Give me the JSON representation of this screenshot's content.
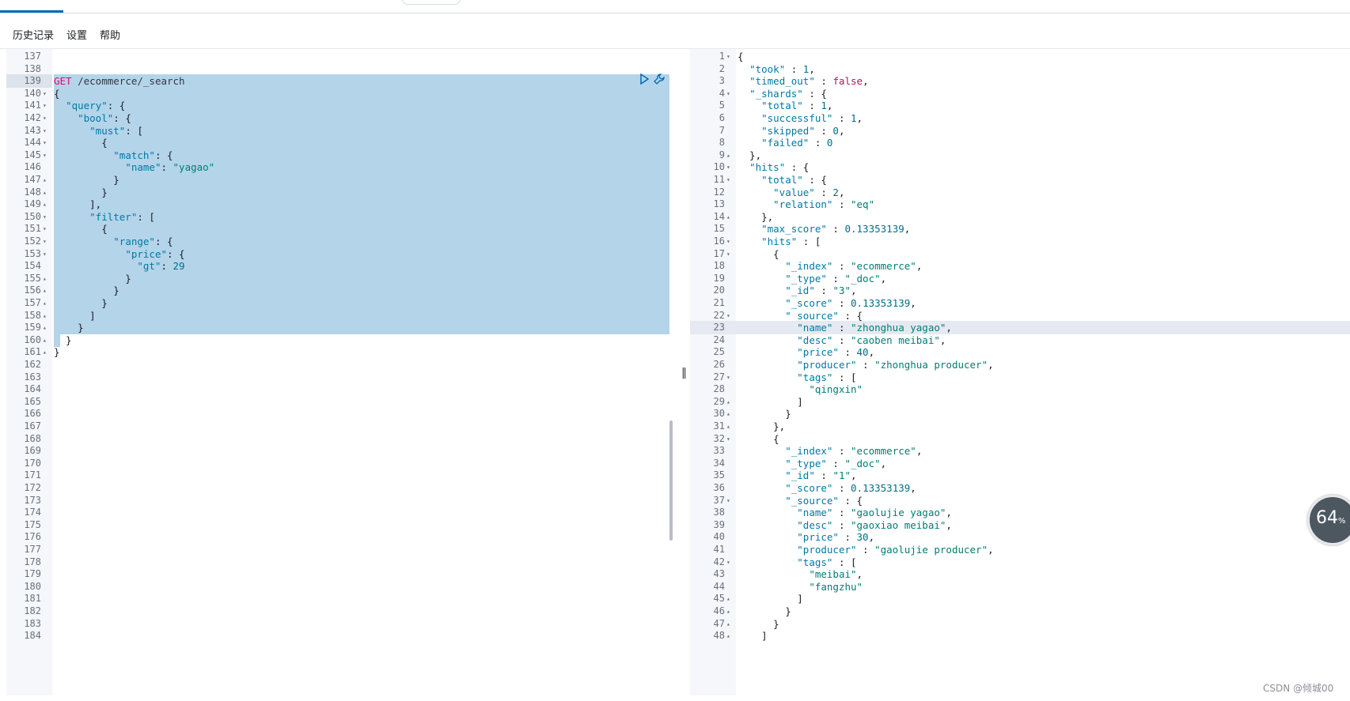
{
  "menu": {
    "history": "历史记录",
    "settings": "设置",
    "help": "帮助"
  },
  "watermark": "CSDN @倾城00",
  "perf": {
    "value": "64",
    "unit": "%"
  },
  "left": {
    "lines": [
      {
        "n": "137",
        "f": "",
        "t": ""
      },
      {
        "n": "138",
        "f": "",
        "t": ""
      },
      {
        "n": "139",
        "f": "",
        "t": "GET /ecommerce/_search"
      },
      {
        "n": "140",
        "f": "▾",
        "t": "{"
      },
      {
        "n": "141",
        "f": "▾",
        "t": "  \"query\": {"
      },
      {
        "n": "142",
        "f": "▾",
        "t": "    \"bool\": {"
      },
      {
        "n": "143",
        "f": "▾",
        "t": "      \"must\": ["
      },
      {
        "n": "144",
        "f": "▾",
        "t": "        {"
      },
      {
        "n": "145",
        "f": "▾",
        "t": "          \"match\": {"
      },
      {
        "n": "146",
        "f": "",
        "t": "            \"name\": \"yagao\""
      },
      {
        "n": "147",
        "f": "▴",
        "t": "          }"
      },
      {
        "n": "148",
        "f": "▴",
        "t": "        }"
      },
      {
        "n": "149",
        "f": "▴",
        "t": "      ],"
      },
      {
        "n": "150",
        "f": "▾",
        "t": "      \"filter\": ["
      },
      {
        "n": "151",
        "f": "▾",
        "t": "        {"
      },
      {
        "n": "152",
        "f": "▾",
        "t": "          \"range\": {"
      },
      {
        "n": "153",
        "f": "▾",
        "t": "            \"price\": {"
      },
      {
        "n": "154",
        "f": "",
        "t": "              \"gt\": 29"
      },
      {
        "n": "155",
        "f": "▴",
        "t": "            }"
      },
      {
        "n": "156",
        "f": "▴",
        "t": "          }"
      },
      {
        "n": "157",
        "f": "▴",
        "t": "        }"
      },
      {
        "n": "158",
        "f": "▴",
        "t": "      ]"
      },
      {
        "n": "159",
        "f": "▴",
        "t": "    }"
      },
      {
        "n": "160",
        "f": "▴",
        "t": "  }"
      },
      {
        "n": "161",
        "f": "▴",
        "t": "}"
      },
      {
        "n": "162",
        "f": "",
        "t": ""
      },
      {
        "n": "163",
        "f": "",
        "t": ""
      },
      {
        "n": "164",
        "f": "",
        "t": ""
      },
      {
        "n": "165",
        "f": "",
        "t": ""
      },
      {
        "n": "166",
        "f": "",
        "t": ""
      },
      {
        "n": "167",
        "f": "",
        "t": ""
      },
      {
        "n": "168",
        "f": "",
        "t": ""
      },
      {
        "n": "169",
        "f": "",
        "t": ""
      },
      {
        "n": "170",
        "f": "",
        "t": ""
      },
      {
        "n": "171",
        "f": "",
        "t": ""
      },
      {
        "n": "172",
        "f": "",
        "t": ""
      },
      {
        "n": "173",
        "f": "",
        "t": ""
      },
      {
        "n": "174",
        "f": "",
        "t": ""
      },
      {
        "n": "175",
        "f": "",
        "t": ""
      },
      {
        "n": "176",
        "f": "",
        "t": ""
      },
      {
        "n": "177",
        "f": "",
        "t": ""
      },
      {
        "n": "178",
        "f": "",
        "t": ""
      },
      {
        "n": "179",
        "f": "",
        "t": ""
      },
      {
        "n": "180",
        "f": "",
        "t": ""
      },
      {
        "n": "181",
        "f": "",
        "t": ""
      },
      {
        "n": "182",
        "f": "",
        "t": ""
      },
      {
        "n": "183",
        "f": "",
        "t": ""
      },
      {
        "n": "184",
        "f": "",
        "t": ""
      }
    ]
  },
  "right": {
    "lines": [
      {
        "n": "1",
        "f": "▾",
        "t": "{"
      },
      {
        "n": "2",
        "f": "",
        "t": "  \"took\" : 1,"
      },
      {
        "n": "3",
        "f": "",
        "t": "  \"timed_out\" : false,"
      },
      {
        "n": "4",
        "f": "▾",
        "t": "  \"_shards\" : {"
      },
      {
        "n": "5",
        "f": "",
        "t": "    \"total\" : 1,"
      },
      {
        "n": "6",
        "f": "",
        "t": "    \"successful\" : 1,"
      },
      {
        "n": "7",
        "f": "",
        "t": "    \"skipped\" : 0,"
      },
      {
        "n": "8",
        "f": "",
        "t": "    \"failed\" : 0"
      },
      {
        "n": "9",
        "f": "▴",
        "t": "  },"
      },
      {
        "n": "10",
        "f": "▾",
        "t": "  \"hits\" : {"
      },
      {
        "n": "11",
        "f": "▾",
        "t": "    \"total\" : {"
      },
      {
        "n": "12",
        "f": "",
        "t": "      \"value\" : 2,"
      },
      {
        "n": "13",
        "f": "",
        "t": "      \"relation\" : \"eq\""
      },
      {
        "n": "14",
        "f": "▴",
        "t": "    },"
      },
      {
        "n": "15",
        "f": "",
        "t": "    \"max_score\" : 0.13353139,"
      },
      {
        "n": "16",
        "f": "▾",
        "t": "    \"hits\" : ["
      },
      {
        "n": "17",
        "f": "▾",
        "t": "      {"
      },
      {
        "n": "18",
        "f": "",
        "t": "        \"_index\" : \"ecommerce\","
      },
      {
        "n": "19",
        "f": "",
        "t": "        \"_type\" : \"_doc\","
      },
      {
        "n": "20",
        "f": "",
        "t": "        \"_id\" : \"3\","
      },
      {
        "n": "21",
        "f": "",
        "t": "        \"_score\" : 0.13353139,"
      },
      {
        "n": "22",
        "f": "▾",
        "t": "        \"_source\" : {"
      },
      {
        "n": "23",
        "f": "",
        "t": "          \"name\" : \"zhonghua yagao\","
      },
      {
        "n": "24",
        "f": "",
        "t": "          \"desc\" : \"caoben meibai\","
      },
      {
        "n": "25",
        "f": "",
        "t": "          \"price\" : 40,"
      },
      {
        "n": "26",
        "f": "",
        "t": "          \"producer\" : \"zhonghua producer\","
      },
      {
        "n": "27",
        "f": "▾",
        "t": "          \"tags\" : ["
      },
      {
        "n": "28",
        "f": "",
        "t": "            \"qingxin\""
      },
      {
        "n": "29",
        "f": "▴",
        "t": "          ]"
      },
      {
        "n": "30",
        "f": "▴",
        "t": "        }"
      },
      {
        "n": "31",
        "f": "▴",
        "t": "      },"
      },
      {
        "n": "32",
        "f": "▾",
        "t": "      {"
      },
      {
        "n": "33",
        "f": "",
        "t": "        \"_index\" : \"ecommerce\","
      },
      {
        "n": "34",
        "f": "",
        "t": "        \"_type\" : \"_doc\","
      },
      {
        "n": "35",
        "f": "",
        "t": "        \"_id\" : \"1\","
      },
      {
        "n": "36",
        "f": "",
        "t": "        \"_score\" : 0.13353139,"
      },
      {
        "n": "37",
        "f": "▾",
        "t": "        \"_source\" : {"
      },
      {
        "n": "38",
        "f": "",
        "t": "          \"name\" : \"gaolujie yagao\","
      },
      {
        "n": "39",
        "f": "",
        "t": "          \"desc\" : \"gaoxiao meibai\","
      },
      {
        "n": "40",
        "f": "",
        "t": "          \"price\" : 30,"
      },
      {
        "n": "41",
        "f": "",
        "t": "          \"producer\" : \"gaolujie producer\","
      },
      {
        "n": "42",
        "f": "▾",
        "t": "          \"tags\" : ["
      },
      {
        "n": "43",
        "f": "",
        "t": "            \"meibai\","
      },
      {
        "n": "44",
        "f": "",
        "t": "            \"fangzhu\""
      },
      {
        "n": "45",
        "f": "▴",
        "t": "          ]"
      },
      {
        "n": "46",
        "f": "▴",
        "t": "        }"
      },
      {
        "n": "47",
        "f": "▴",
        "t": "      }"
      },
      {
        "n": "48",
        "f": "▴",
        "t": "    ]"
      }
    ]
  }
}
